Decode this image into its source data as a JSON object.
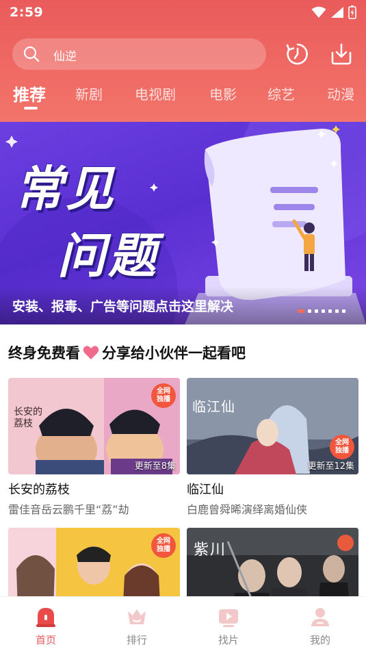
{
  "status_bar": {
    "time": "2:59"
  },
  "search": {
    "query": "仙逆"
  },
  "tabs": [
    {
      "label": "推荐",
      "active": true
    },
    {
      "label": "新剧"
    },
    {
      "label": "电视剧"
    },
    {
      "label": "电影"
    },
    {
      "label": "综艺"
    },
    {
      "label": "动漫"
    }
  ],
  "banner": {
    "title_line1": "常见",
    "title_line2": "问题",
    "caption": "安装、报毒、广告等问题点击这里解决",
    "slide_count": 7,
    "active_slide": 1
  },
  "section": {
    "title_left": "终身免费看",
    "title_right": "分享给小伙伴一起看吧"
  },
  "cards": [
    {
      "title": "长安的荔枝",
      "subtitle": "雷佳音岳云鹏千里“荔”劫",
      "episodes": "更新至8集",
      "badge": "全网独播",
      "poster_text": "长安的荔枝"
    },
    {
      "title": "临江仙",
      "subtitle": "白鹿曾舜晞演绎离婚仙侠",
      "episodes": "更新至12集",
      "badge": "全网独播",
      "poster_text": "临江仙"
    },
    {
      "title": "",
      "subtitle": "",
      "episodes": "",
      "badge": "全网独播",
      "poster_text": ""
    },
    {
      "title": "",
      "subtitle": "",
      "episodes": "",
      "badge": "",
      "poster_text": "紫川"
    }
  ],
  "bottom_nav": [
    {
      "label": "首页",
      "icon": "home-icon",
      "active": true
    },
    {
      "label": "排行",
      "icon": "crown-icon"
    },
    {
      "label": "找片",
      "icon": "play-icon"
    },
    {
      "label": "我的",
      "icon": "user-icon"
    }
  ],
  "colors": {
    "accent": "#e95b5b",
    "banner": "#5a2fd2",
    "badge": "#f2563d"
  }
}
